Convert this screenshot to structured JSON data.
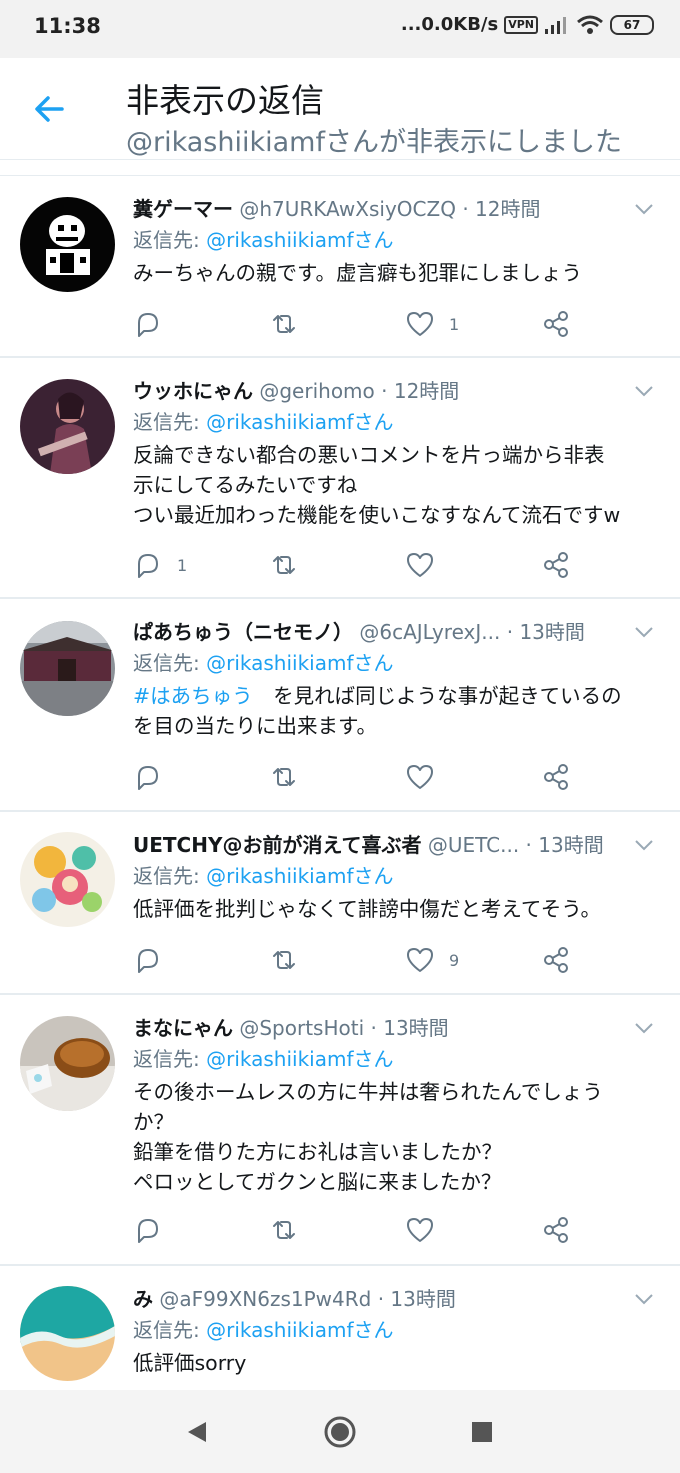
{
  "status_bar": {
    "time": "11:38",
    "net_speed": "...0.0KB/s",
    "vpn": "VPN",
    "battery": "67"
  },
  "header": {
    "title": "非表示の返信",
    "subtitle": "@rikashiikiamfさんが非表示にしました"
  },
  "reply_to_label": "返信先: ",
  "tweets": [
    {
      "name": "糞ゲーマー",
      "handle": "@h7URKAwXsiyOCZQ",
      "time": "12時間",
      "reply_to": "@rikashiikiamfさん",
      "text": "みーちゃんの親です。虚言癖も犯罪にしましょう",
      "replies": "",
      "likes": "1"
    },
    {
      "name": "ウッホにゃん",
      "handle": "@gerihomo",
      "time": "12時間",
      "reply_to": "@rikashiikiamfさん",
      "text_lines": [
        "反論できない都合の悪いコメントを片っ端から非表",
        "示にしてるみたいですね",
        "つい最近加わった機能を使いこなすなんて流石ですw"
      ],
      "replies": "1",
      "likes": ""
    },
    {
      "name": "ぱあちゅう（ニセモノ）",
      "handle": "@6cAJLyrexJ...",
      "time": "13時間",
      "reply_to": "@rikashiikiamfさん",
      "hashtag": "#はあちゅう",
      "text_after_hashtag": "　を見れば同じような事が起きているの",
      "text_line2": "を目の当たりに出来ます。",
      "replies": "",
      "likes": ""
    },
    {
      "name": "UETCHY@お前が消えて喜ぶ者",
      "handle": "@UETC...",
      "time": "13時間",
      "reply_to": "@rikashiikiamfさん",
      "text": "低評価を批判じゃなくて誹謗中傷だと考えてそう。",
      "replies": "",
      "likes": "9"
    },
    {
      "name": "まなにゃん",
      "handle": "@SportsHoti",
      "time": "13時間",
      "reply_to": "@rikashiikiamfさん",
      "text_lines": [
        "その後ホームレスの方に牛丼は奢られたんでしょう",
        "か？",
        "鉛筆を借りた方にお礼は言いましたか？",
        "ペロッとしてガクンと脳に来ましたか？"
      ],
      "replies": "",
      "likes": ""
    },
    {
      "name": "み",
      "handle": "@aF99XN6zs1Pw4Rd",
      "time": "13時間",
      "reply_to": "@rikashiikiamfさん",
      "text": "低評価sorry"
    }
  ],
  "colors": {
    "accent": "#1da1f2",
    "muted": "#657786",
    "text": "#14171a"
  },
  "icons": [
    "back-arrow-icon",
    "reply-icon",
    "retweet-icon",
    "like-icon",
    "share-icon",
    "chevron-down-icon",
    "nav-back-icon",
    "nav-home-icon",
    "nav-recents-icon"
  ]
}
